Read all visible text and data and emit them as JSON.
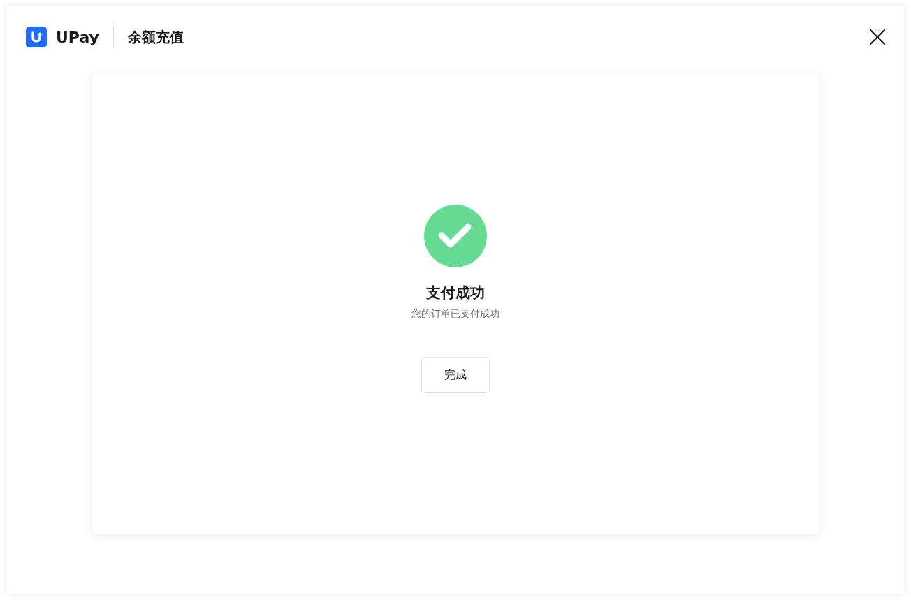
{
  "header": {
    "brand": "UPay",
    "title": "余额充值"
  },
  "result": {
    "kind": "success",
    "title": "支付成功",
    "message": "您的订单已支付成功"
  },
  "buttons": [
    {
      "label": "完成"
    }
  ]
}
